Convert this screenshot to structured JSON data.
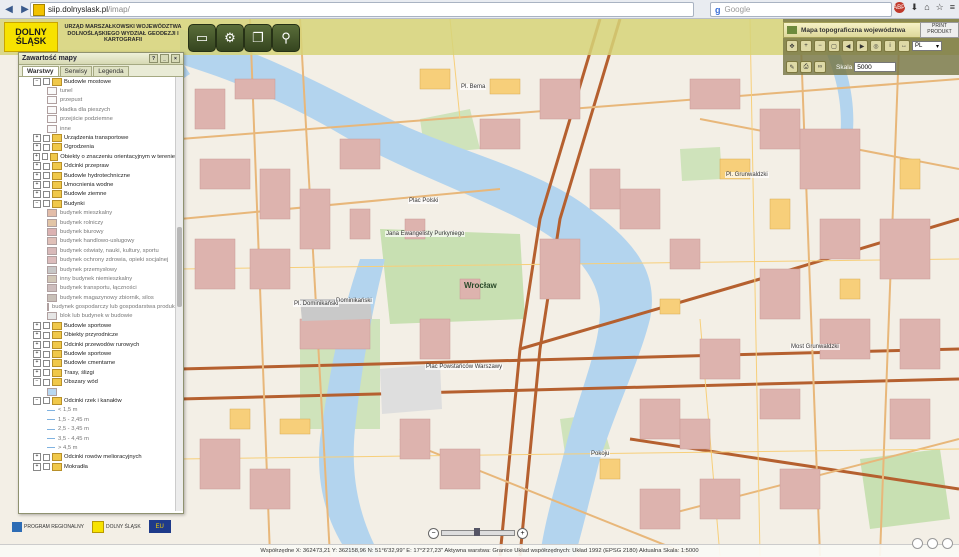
{
  "browser": {
    "url_host": "siip.dolnyslask.pl",
    "url_path": "/imap/",
    "search_placeholder": "Google"
  },
  "header": {
    "logo_line1": "DOLNY",
    "logo_line2": "ŚLĄSK",
    "org_title": "URZĄD MARSZAŁKOWSKI WOJEWÓDZTWA DOLNOŚLĄSKIEGO WYDZIAŁ GEODEZJI I KARTOGRAFII"
  },
  "right_panel": {
    "title": "Mapa topograficzna województwa",
    "button": "PRINT PRODUKT",
    "language": "PL",
    "scale_label": "Skala",
    "scale_value": "5000"
  },
  "panel": {
    "title": "Zawartość mapy",
    "tabs": [
      {
        "label": "Warstwy",
        "active": true
      },
      {
        "label": "Serwisy",
        "active": false
      },
      {
        "label": "Legenda",
        "active": false
      }
    ],
    "tree": [
      {
        "label": "Budowle mostowe",
        "kind": "group",
        "open": true
      },
      {
        "label": "tunel",
        "kind": "sub"
      },
      {
        "label": "przepust",
        "kind": "sub"
      },
      {
        "label": "kładka dla pieszych",
        "kind": "sub"
      },
      {
        "label": "przejście podziemne",
        "kind": "sub"
      },
      {
        "label": "inne",
        "kind": "sub"
      },
      {
        "label": "Urządzenia transportowe",
        "kind": "group"
      },
      {
        "label": "Ogrodzenia",
        "kind": "group"
      },
      {
        "label": "Obiekty o znaczeniu orientacyjnym w terenie",
        "kind": "group"
      },
      {
        "label": "Odcinki przepraw",
        "kind": "group"
      },
      {
        "label": "Budowle hydrotechniczne",
        "kind": "group"
      },
      {
        "label": "Umocnienia wodne",
        "kind": "group"
      },
      {
        "label": "Budowle ziemne",
        "kind": "group"
      },
      {
        "label": "Budynki",
        "kind": "group",
        "open": true
      },
      {
        "label": "budynek mieszkalny",
        "kind": "swatch",
        "color": "#e3bda9"
      },
      {
        "label": "budynek rolniczy",
        "kind": "swatch",
        "color": "#e2c5a6"
      },
      {
        "label": "budynek biurowy",
        "kind": "swatch",
        "color": "#dcb2b2"
      },
      {
        "label": "budynek handlowo-usługowy",
        "kind": "swatch",
        "color": "#e0c0b8"
      },
      {
        "label": "budynek oświaty, nauki, kultury, sportu",
        "kind": "swatch",
        "color": "#d8b9b9"
      },
      {
        "label": "budynek ochrony zdrowia, opieki socjalnej",
        "kind": "swatch",
        "color": "#dcbcbc"
      },
      {
        "label": "budynek przemysłowy",
        "kind": "swatch",
        "color": "#c7c7c7"
      },
      {
        "label": "inny budynek niemieszkalny",
        "kind": "swatch",
        "color": "#d1c7b6"
      },
      {
        "label": "budynek transportu, łączności",
        "kind": "swatch",
        "color": "#cdbdbd"
      },
      {
        "label": "budynek magazynowy zbiornik, silos",
        "kind": "swatch",
        "color": "#c8c0b8"
      },
      {
        "label": "budynek gospodarczy lub gospodarstwa produkcyjnego",
        "kind": "swatch",
        "color": "#d2c8bc"
      },
      {
        "label": "blok lub budynek w budowie",
        "kind": "swatch",
        "color": "#e6e6e6"
      },
      {
        "label": "Budowle sportowe",
        "kind": "group"
      },
      {
        "label": "Obiekty przyrodnicze",
        "kind": "group"
      },
      {
        "label": "Odcinki przewodów rurowych",
        "kind": "group"
      },
      {
        "label": "Budowle sportowe",
        "kind": "group"
      },
      {
        "label": "Budowle cmentarne",
        "kind": "group"
      },
      {
        "label": "Trasy, ślizgi",
        "kind": "group"
      },
      {
        "label": "Obszary wód",
        "kind": "group",
        "open": true
      },
      {
        "label": "",
        "kind": "swatch",
        "color": "#b8d8f2"
      },
      {
        "label": "Odcinki rzek i kanałów",
        "kind": "group",
        "open": true
      },
      {
        "label": "< 1,5 m",
        "kind": "line",
        "color": "#7fb2e0"
      },
      {
        "label": "1,5 - 2,45 m",
        "kind": "line",
        "color": "#7fb2e0"
      },
      {
        "label": "2,5 - 3,45 m",
        "kind": "line",
        "color": "#7fb2e0"
      },
      {
        "label": "3,5 - 4,45 m",
        "kind": "line",
        "color": "#7fb2e0"
      },
      {
        "label": "> 4,5 m",
        "kind": "line",
        "color": "#7fb2e0"
      },
      {
        "label": "Odcinki rowów melioracyjnych",
        "kind": "group"
      },
      {
        "label": "Mokradła",
        "kind": "group"
      }
    ]
  },
  "footer_logos": {
    "program_label": "PROGRAM REGIONALNY",
    "dolny_label": "DOLNY ŚLĄSK",
    "eu_label": "EU"
  },
  "status": {
    "text": "Współrzędne X: 362473,21 Y: 362158,96   N: 51°6'32,99\" E: 17°2'27,23\"   Aktywna warstwa: Granice   Układ współrzędnych: Układ 1992 (EPSG 2180)   Aktualna Skala: 1:5000"
  },
  "map_labels": {
    "main": "Wrocław",
    "labels": [
      "Plac Polski",
      "Jana Ewangelisty Purkyniego",
      "Pl. Bema",
      "Dominikański",
      "Plac Powstańców Warszawy",
      "Pl. Grunwaldzki",
      "Most Grunwaldzki",
      "Pokoju",
      "Pl. Dominikański"
    ]
  },
  "colors": {
    "water": "#b3d4ee",
    "park": "#c8e0b2",
    "building": "#ddb3ae",
    "road_main": "#b5602f",
    "road_minor": "#f7cf7a",
    "header_bg": "#d6d478"
  }
}
